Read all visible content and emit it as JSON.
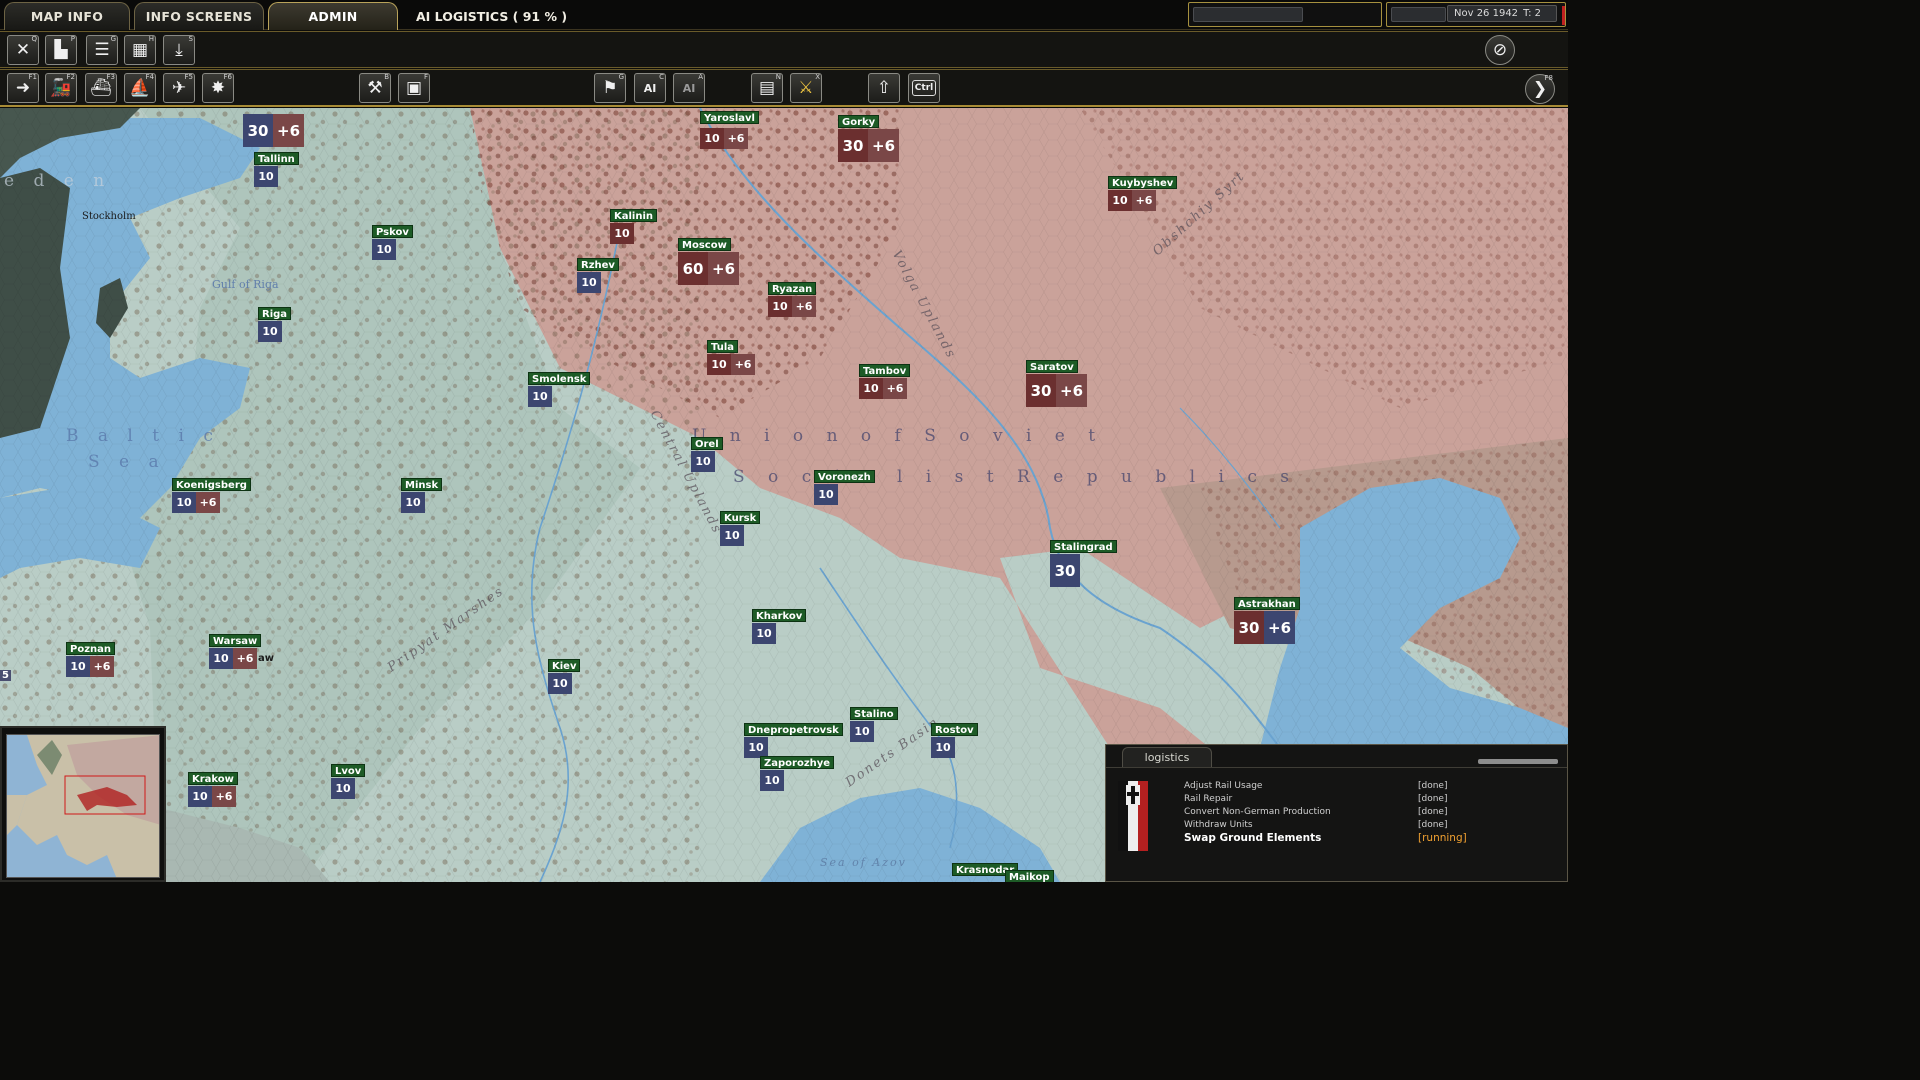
{
  "tabs": [
    {
      "label": "MAP INFO"
    },
    {
      "label": "INFO SCREENS"
    },
    {
      "label": "ADMIN"
    }
  ],
  "ai_status": "AI LOGISTICS   ( 91 % )",
  "date": "Nov 26 1942",
  "turn": "T: 2",
  "toolbar1": [
    {
      "hotkey": "Q"
    },
    {
      "hotkey": "P"
    },
    {
      "hotkey": "G"
    },
    {
      "hotkey": "H"
    },
    {
      "hotkey": "S"
    }
  ],
  "toolbar2": {
    "buttons": [
      {
        "hotkey": "F1"
      },
      {
        "hotkey": "F2"
      },
      {
        "hotkey": "F3"
      },
      {
        "hotkey": "F4"
      },
      {
        "hotkey": "F5"
      },
      {
        "hotkey": "F6"
      },
      {
        "hotkey": "B"
      },
      {
        "hotkey": "F"
      },
      {
        "hotkey": "G"
      },
      {
        "hotkey": "C",
        "text": "AI"
      },
      {
        "hotkey": "A",
        "text": "AI"
      },
      {
        "hotkey": "N"
      },
      {
        "hotkey": "X"
      },
      {
        "hotkey": ""
      },
      {
        "hotkey": "",
        "text": "Ctrl"
      },
      {
        "hotkey": "F8"
      }
    ]
  },
  "map": {
    "regions": [
      {
        "text": "U n i o n   o f   S o v i e t"
      },
      {
        "text": "S o c i a l i s t   R e p u b l i c s"
      }
    ],
    "seas": [
      {
        "text": "B a l t i c"
      },
      {
        "text": "S e a"
      },
      {
        "text": "e d e n"
      }
    ],
    "features": [
      {
        "text": "Volga Uplands"
      },
      {
        "text": "Obshchiy Syrt"
      },
      {
        "text": "Pripyat Marshes"
      },
      {
        "text": "Donets Basin"
      },
      {
        "text": "Sea of Azov"
      },
      {
        "text": "Gulf of Riga"
      },
      {
        "text": "Stockholm"
      },
      {
        "text": "Central Uplands"
      }
    ],
    "cities": [
      {
        "name": "Yaroslavl",
        "values": [
          "10",
          "+6"
        ],
        "size": "s",
        "tint": "red"
      },
      {
        "name": "Gorky",
        "values": [
          "30",
          "+6"
        ],
        "size": "l",
        "tint": "red"
      },
      {
        "name": "Kuybyshev",
        "values": [
          "10",
          "+6"
        ],
        "size": "s",
        "tint": "red"
      },
      {
        "name": "Tallinn",
        "values": [
          "10"
        ],
        "size": "s",
        "tint": ""
      },
      {
        "name": "Pskov",
        "values": [
          "10"
        ],
        "size": "s",
        "tint": ""
      },
      {
        "name": "Kalinin",
        "values": [
          "10"
        ],
        "size": "s",
        "tint": "red"
      },
      {
        "name": "Moscow",
        "values": [
          "60",
          "+6"
        ],
        "size": "l",
        "tint": "red"
      },
      {
        "name": "Rzhev",
        "values": [
          "10"
        ],
        "size": "s",
        "tint": ""
      },
      {
        "name": "Ryazan",
        "values": [
          "10",
          "+6"
        ],
        "size": "s",
        "tint": "red"
      },
      {
        "name": "Riga",
        "values": [
          "10"
        ],
        "size": "s",
        "tint": ""
      },
      {
        "name": "Tula",
        "values": [
          "10",
          "+6"
        ],
        "size": "s",
        "tint": "red"
      },
      {
        "name": "Tambov",
        "values": [
          "10",
          "+6"
        ],
        "size": "s",
        "tint": "red"
      },
      {
        "name": "Saratov",
        "values": [
          "30",
          "+6"
        ],
        "size": "l",
        "tint": "red"
      },
      {
        "name": "Smolensk",
        "values": [
          "10"
        ],
        "size": "s",
        "tint": ""
      },
      {
        "name": "Orel",
        "values": [
          "10"
        ],
        "size": "s",
        "tint": ""
      },
      {
        "name": "Voronezh",
        "values": [
          "10"
        ],
        "size": "s",
        "tint": ""
      },
      {
        "name": "Koenigsberg",
        "values": [
          "10",
          "+6"
        ],
        "size": "s",
        "tint": "mix"
      },
      {
        "name": "Minsk",
        "values": [
          "10"
        ],
        "size": "s",
        "tint": ""
      },
      {
        "name": "Kursk",
        "values": [
          "10"
        ],
        "size": "s",
        "tint": ""
      },
      {
        "name": "Stalingrad",
        "values": [
          "30"
        ],
        "size": "l",
        "tint": ""
      },
      {
        "name": "Astrakhan",
        "values": [
          "30",
          "+6"
        ],
        "size": "l",
        "tint": "mix"
      },
      {
        "name": "Kharkov",
        "values": [
          "10"
        ],
        "size": "s",
        "tint": ""
      },
      {
        "name": "Poznan",
        "values": [
          "10",
          "+6"
        ],
        "size": "s",
        "tint": "mix"
      },
      {
        "name": "Warsaw",
        "values": [
          "10",
          "+6"
        ],
        "size": "s",
        "tint": "mix"
      },
      {
        "name": "Kiev",
        "values": [
          "10"
        ],
        "size": "s",
        "tint": ""
      },
      {
        "name": "Stalino",
        "values": [
          "10"
        ],
        "size": "s",
        "tint": ""
      },
      {
        "name": "Dnepropetrovsk",
        "values": [
          "10"
        ],
        "size": "s",
        "tint": ""
      },
      {
        "name": "Rostov",
        "values": [
          "10"
        ],
        "size": "s",
        "tint": ""
      },
      {
        "name": "Zaporozhye",
        "values": [
          "10"
        ],
        "size": "s",
        "tint": ""
      },
      {
        "name": "Krakow",
        "values": [
          "10",
          "+6"
        ],
        "size": "s",
        "tint": "mix"
      },
      {
        "name": "Lvov",
        "values": [
          "10"
        ],
        "size": "s",
        "tint": ""
      },
      {
        "name": "Krasnodar",
        "values": [],
        "size": "s",
        "tint": ""
      },
      {
        "name": "Maikop",
        "values": [],
        "size": "s",
        "tint": ""
      },
      {
        "name": "",
        "values": [
          "30",
          "+6"
        ],
        "size": "l",
        "tint": "mix"
      }
    ],
    "edge_labels": [
      {
        "text": "5"
      },
      {
        "text": "aw"
      }
    ]
  },
  "logistics": {
    "tab": "logistics",
    "tasks": [
      {
        "name": "Adjust Rail Usage",
        "status": "[done]"
      },
      {
        "name": "Rail Repair",
        "status": "[done]"
      },
      {
        "name": "Convert Non-German Production",
        "status": "[done]"
      },
      {
        "name": "Withdraw Units",
        "status": "[done]"
      },
      {
        "name": "Swap Ground Elements",
        "status": "[running]"
      }
    ]
  },
  "colors": {
    "accent_gold": "#a88c36",
    "city_label_green": "#1d5b26",
    "soviet_territory": "#caa29a",
    "axis_territory": "#b9cdc6",
    "sea": "#7fb2d6",
    "running": "#f0a030"
  }
}
